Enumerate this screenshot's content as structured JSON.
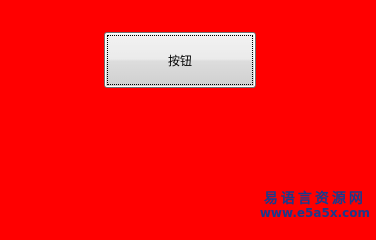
{
  "window": {
    "background": "#ff0000"
  },
  "button": {
    "label": "按钮"
  },
  "watermark": {
    "title": "易语言资源网",
    "url": "www.e5a5x.com",
    "title_color": "#1a3a8c",
    "url_color": "#1a3a8c"
  }
}
